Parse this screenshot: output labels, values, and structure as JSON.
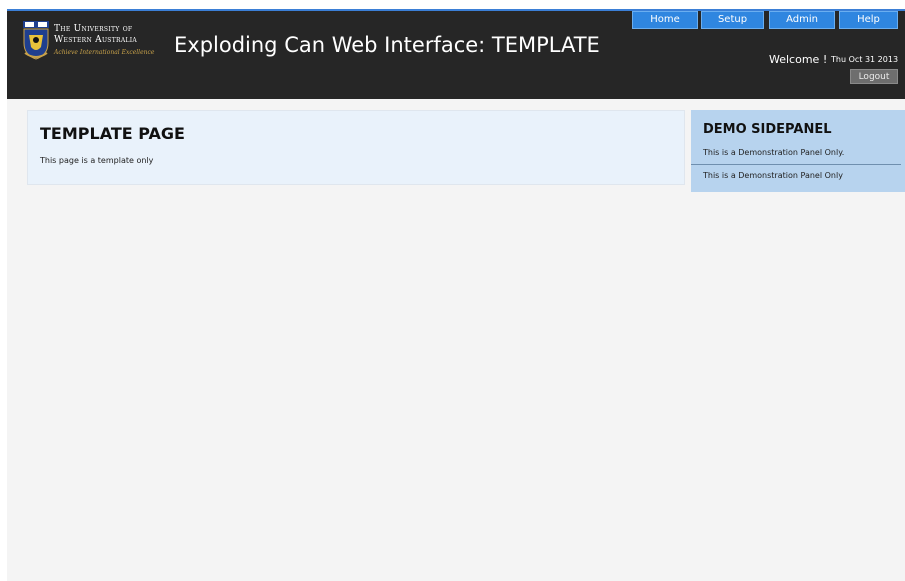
{
  "header": {
    "university_line1": "The University of",
    "university_line2": "Western Australia",
    "university_motto": "Achieve International Excellence",
    "app_title": "Exploding Can Web Interface: TEMPLATE"
  },
  "nav": {
    "items": [
      {
        "label": "Home"
      },
      {
        "label": "Setup"
      },
      {
        "label": "Admin"
      },
      {
        "label": "Help"
      }
    ]
  },
  "user": {
    "welcome": "Welcome !",
    "date": "Thu Oct 31 2013",
    "logout_label": "Logout"
  },
  "main": {
    "title": "TEMPLATE PAGE",
    "text": "This page is a template only"
  },
  "sidepanel": {
    "title": "DEMO SIDEPANEL",
    "text1": "This is a Demonstration Panel Only.",
    "text2": "This is a Demonstration Panel Only"
  },
  "colors": {
    "header_bg": "#262626",
    "nav_button": "#2f86e0",
    "main_panel_bg": "#e9f2fb",
    "side_panel_bg": "#b7d3ee"
  }
}
